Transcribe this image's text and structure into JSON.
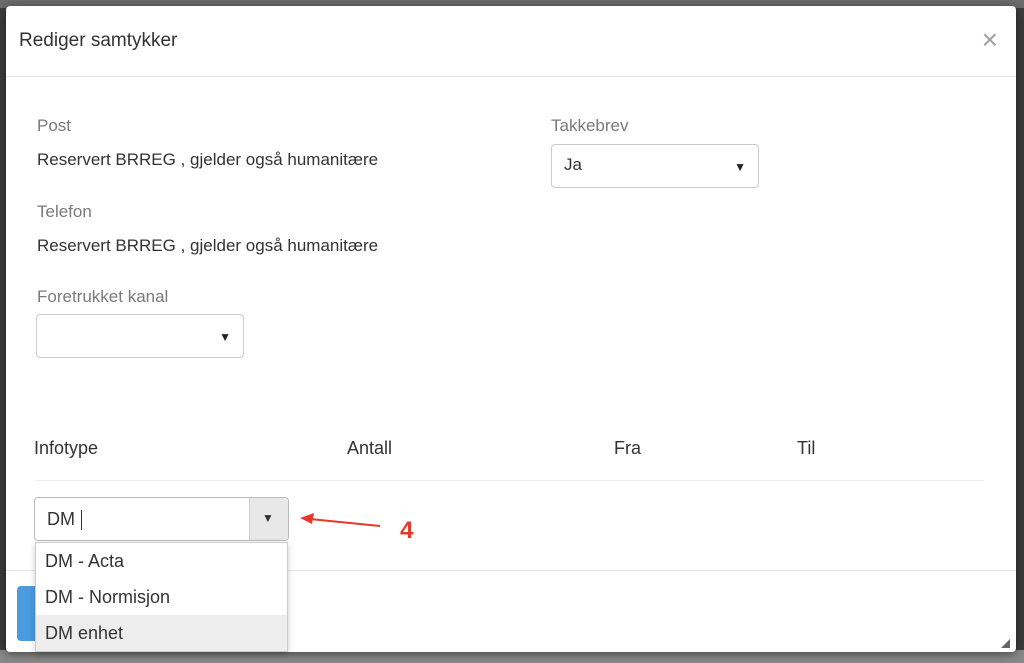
{
  "dialog": {
    "title": "Rediger samtykker",
    "close_glyph": "×"
  },
  "fields": {
    "post": {
      "label": "Post",
      "value": "Reservert BRREG , gjelder også humanitære"
    },
    "telefon": {
      "label": "Telefon",
      "value": "Reservert BRREG , gjelder også humanitære"
    },
    "foretrukket_kanal": {
      "label": "Foretrukket kanal",
      "selected": ""
    },
    "takkebrev": {
      "label": "Takkebrev",
      "selected": "Ja"
    }
  },
  "table": {
    "columns": [
      "Infotype",
      "Antall",
      "Fra",
      "Til"
    ]
  },
  "infotype_combo": {
    "value": "DM",
    "options": [
      "DM - Acta",
      "DM - Normisjon",
      "DM enhet"
    ],
    "highlighted_index": 2
  },
  "annotation": {
    "number": "4",
    "color": "#e53a2b"
  },
  "icons": {
    "caret": "▼",
    "close": "close-icon"
  }
}
